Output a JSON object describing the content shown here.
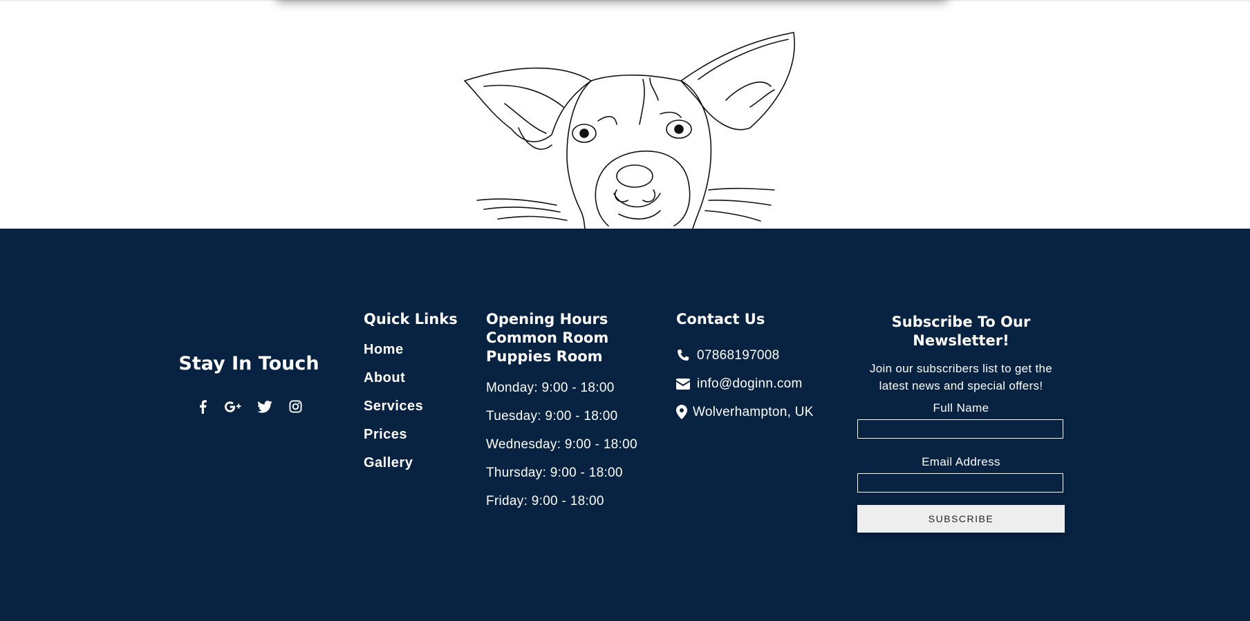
{
  "footer": {
    "stay_in_touch": {
      "title": "Stay In Touch",
      "social_icons": [
        "facebook-icon",
        "google-plus-icon",
        "twitter-icon",
        "instagram-icon"
      ]
    },
    "quick_links": {
      "title": "Quick Links",
      "items": [
        "Home",
        "About",
        "Services",
        "Prices",
        "Gallery"
      ]
    },
    "opening_hours": {
      "title_lines": [
        "Opening Hours",
        "Common Room",
        "Puppies Room"
      ],
      "items": [
        "Monday: 9:00 - 18:00",
        "Tuesday: 9:00 - 18:00",
        "Wednesday: 9:00 - 18:00",
        "Thursday: 9:00 - 18:00",
        "Friday: 9:00 - 18:00"
      ]
    },
    "contact": {
      "title": "Contact Us",
      "phone": "07868197008",
      "email": "info@doginn.com",
      "location": "Wolverhampton, UK"
    },
    "newsletter": {
      "title": "Subscribe To Our Newsletter!",
      "description": "Join our subscribers list to get the latest news and special offers!",
      "name_label": "Full Name",
      "email_label": "Email Address",
      "button_label": "SUBSCRIBE"
    }
  },
  "colors": {
    "footer_bg": "#082342",
    "text": "#ffffff",
    "button_bg": "#eeeeee"
  }
}
